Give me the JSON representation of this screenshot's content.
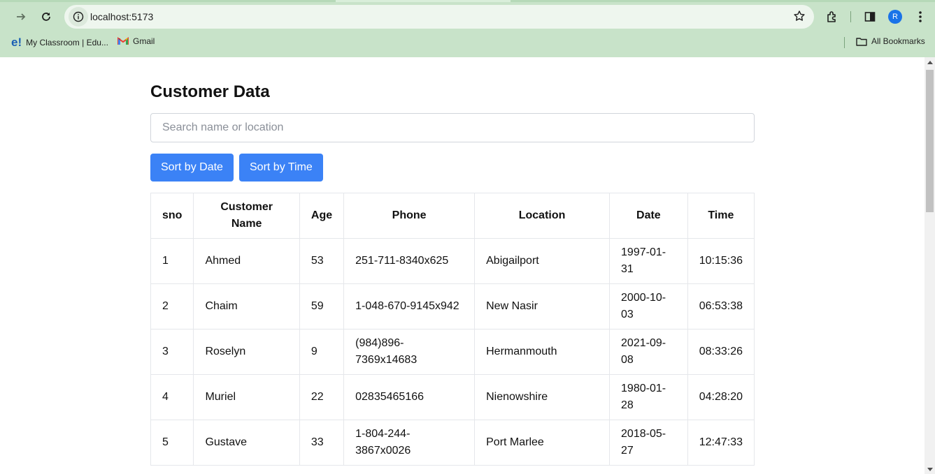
{
  "browser": {
    "url": "localhost:5173",
    "profile_initial": "R",
    "bookmarks": [
      {
        "label": "My Classroom | Edu...",
        "icon": "e!"
      },
      {
        "label": "Gmail",
        "icon": "gmail-icon"
      }
    ],
    "all_bookmarks_label": "All Bookmarks"
  },
  "page": {
    "title": "Customer Data",
    "search": {
      "placeholder": "Search name or location",
      "value": ""
    },
    "buttons": {
      "sort_date": "Sort by Date",
      "sort_time": "Sort by Time"
    }
  },
  "table": {
    "columns": [
      "sno",
      "Customer Name",
      "Age",
      "Phone",
      "Location",
      "Date",
      "Time"
    ],
    "rows": [
      [
        "1",
        "Ahmed",
        "53",
        "251-711-8340x625",
        "Abigailport",
        "1997-01-31",
        "10:15:36"
      ],
      [
        "2",
        "Chaim",
        "59",
        "1-048-670-9145x942",
        "New Nasir",
        "2000-10-03",
        "06:53:38"
      ],
      [
        "3",
        "Roselyn",
        "9",
        "(984)896-7369x14683",
        "Hermanmouth",
        "2021-09-08",
        "08:33:26"
      ],
      [
        "4",
        "Muriel",
        "22",
        "02835465166",
        "Nienowshire",
        "1980-01-28",
        "04:28:20"
      ],
      [
        "5",
        "Gustave",
        "33",
        "1-804-244-3867x0026",
        "Port Marlee",
        "2018-05-27",
        "12:47:33"
      ]
    ]
  },
  "colors": {
    "chrome": "#c8e3c9",
    "button": "#3b82f6"
  }
}
